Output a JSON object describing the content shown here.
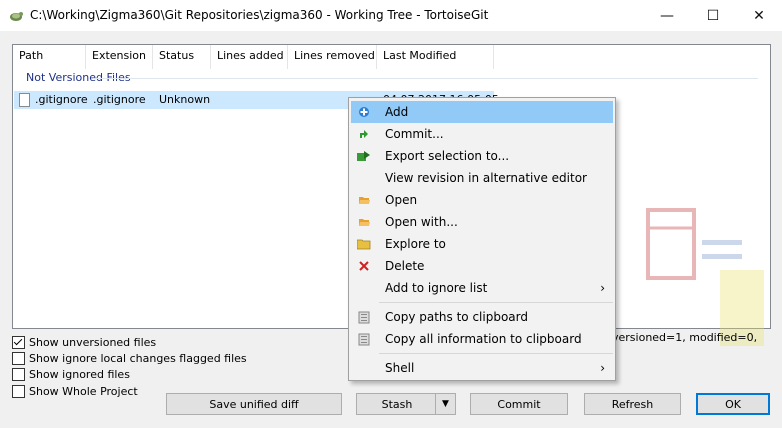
{
  "window": {
    "title": "C:\\Working\\Zigma360\\Git Repositories\\zigma360 - Working Tree - TortoiseGit",
    "minimize_glyph": "—",
    "maximize_glyph": "☐",
    "close_glyph": "✕"
  },
  "list": {
    "columns": [
      "Path",
      "Extension",
      "Status",
      "Lines added",
      "Lines removed",
      "Last Modified"
    ],
    "group_title": "Not Versioned Files",
    "rows": [
      {
        "path": ".gitignore",
        "extension": ".gitignore",
        "status": "Unknown",
        "lines_added": "",
        "lines_removed": "",
        "last_modified": "04.07.2017 16:05:05"
      }
    ]
  },
  "options": {
    "show_unversioned": {
      "label": "Show unversioned files",
      "checked": true
    },
    "show_ignore_local": {
      "label": "Show ignore local changes flagged files",
      "checked": false
    },
    "show_ignored": {
      "label": "Show ignored files",
      "checked": false
    },
    "show_whole_project": {
      "label": "Show Whole Project",
      "checked": false
    }
  },
  "status_text": "versioned=1, modified=0,",
  "buttons": {
    "save_diff": "Save unified diff",
    "stash": "Stash",
    "stash_dropdown": "▼",
    "commit": "Commit",
    "refresh": "Refresh",
    "ok": "OK"
  },
  "context_menu": {
    "items": [
      {
        "label": "Add",
        "icon": "add-icon",
        "highlighted": true
      },
      {
        "label": "Commit...",
        "icon": "commit-icon"
      },
      {
        "label": "Export selection to...",
        "icon": "export-icon"
      },
      {
        "label": "View revision in alternative editor",
        "icon": ""
      },
      {
        "label": "Open",
        "icon": "open-icon"
      },
      {
        "label": "Open with...",
        "icon": "open-with-icon"
      },
      {
        "label": "Explore to",
        "icon": "folder-icon"
      },
      {
        "label": "Delete",
        "icon": "delete-icon"
      },
      {
        "label": "Add to ignore list",
        "icon": "",
        "submenu": "›"
      },
      {
        "label": "Copy paths to clipboard",
        "icon": "clipboard-icon"
      },
      {
        "label": "Copy all information to clipboard",
        "icon": "clipboard-icon"
      },
      {
        "label": "Shell",
        "icon": "",
        "submenu": "›"
      }
    ]
  },
  "colors": {
    "selection": "#cce8ff",
    "menu_highlight": "#91c9f7",
    "group_title": "#1e3287",
    "ok_border": "#0078d7"
  }
}
